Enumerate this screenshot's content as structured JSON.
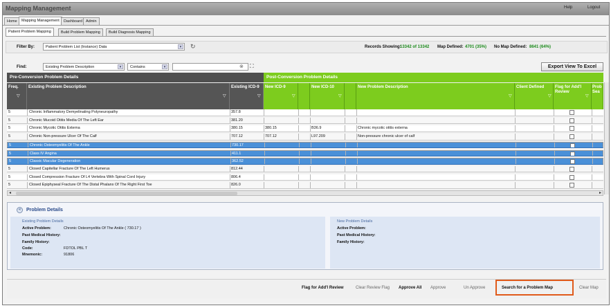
{
  "header": {
    "app_title": "Mapping Management",
    "help": "Help",
    "logout": "Logout"
  },
  "main_tabs": [
    "Home",
    "Mapping Management",
    "Dashboard",
    "Admin"
  ],
  "sub_tabs": [
    "Patient Problem Mapping",
    "Build Problem Mapping",
    "Build Diagnosis Mapping"
  ],
  "filter": {
    "label": "Filter By:",
    "value": "Patient Problem List (Instance) Data",
    "records_label": "Records Showing:",
    "records_value": "13342 of 13342",
    "map_defined_label": "Map Defined:",
    "map_defined_value": "4701 (35%)",
    "no_map_label": "No Map Defined:",
    "no_map_value": "8641 (64%)"
  },
  "find": {
    "label": "Find:",
    "field": "Existing Problem Description",
    "operator": "Contains",
    "value": "",
    "export_label": "Export View To Excel"
  },
  "table": {
    "pre_header": "Pre-Conversion Problem Details",
    "post_header": "Post-Conversion Problem Details",
    "columns": {
      "freq": "Freq.",
      "desc": "Existing Problem Description",
      "icd9": "Existing ICD-9",
      "new_icd9": "New ICD-9",
      "new_icd10": "New ICD-10",
      "new_desc": "New Problem Description",
      "client": "Client Defined",
      "flag": "Flag for Add'l Review",
      "prob": "Prob Sea"
    },
    "rows": [
      {
        "freq": "5",
        "desc": "Chronic Inflammatory Demyelinating Polyneuropathy",
        "icd9": "357.8",
        "new_icd9": "",
        "new_icd10": "",
        "new_desc": "",
        "selected": false
      },
      {
        "freq": "5",
        "desc": "Chronic Mucoid Otitis Media Of The Left Ear",
        "icd9": "381.20",
        "new_icd9": "",
        "new_icd10": "",
        "new_desc": "",
        "selected": false
      },
      {
        "freq": "5",
        "desc": "Chronic Mycotic Otitis Externa",
        "icd9": "380.15",
        "new_icd9": "380.15",
        "new_icd10": "B36.9",
        "new_desc": "Chronic mycotic otitis externa",
        "selected": false
      },
      {
        "freq": "5",
        "desc": "Chronic Non-pressure Ulcer Of The Calf",
        "icd9": "707.12",
        "new_icd9": "707.12",
        "new_icd10": "L97.209",
        "new_desc": "Non-pressure chronic ulcer of calf",
        "selected": false
      },
      {
        "freq": "5",
        "desc": "Chronic Osteomyelitis Of The Ankle",
        "icd9": "730.17",
        "new_icd9": "",
        "new_icd10": "",
        "new_desc": "",
        "selected": true
      },
      {
        "freq": "5",
        "desc": "Class IV Angina",
        "icd9": "411.1",
        "new_icd9": "",
        "new_icd10": "",
        "new_desc": "",
        "selected": true
      },
      {
        "freq": "5",
        "desc": "Classic Macular Degeneration",
        "icd9": "362.52",
        "new_icd9": "",
        "new_icd10": "",
        "new_desc": "",
        "selected": true
      },
      {
        "freq": "5",
        "desc": "Closed Capitellar Fracture Of The Left Humerus",
        "icd9": "812.44",
        "new_icd9": "",
        "new_icd10": "",
        "new_desc": "",
        "selected": false
      },
      {
        "freq": "5",
        "desc": "Closed Compression Fracture Of L4 Vertebra With Spinal Cord Injury",
        "icd9": "806.4",
        "new_icd9": "",
        "new_icd10": "",
        "new_desc": "",
        "selected": false
      },
      {
        "freq": "5",
        "desc": "Closed Epiphyseal Fracture Of The Distal Phalanx Of The Right First Toe",
        "icd9": "826.0",
        "new_icd9": "",
        "new_icd10": "",
        "new_desc": "",
        "selected": false
      }
    ]
  },
  "details": {
    "title": "Problem Details",
    "existing_header": "Existing Problem Details",
    "new_header": "New Problem Details",
    "active_problem_label": "Active Problem:",
    "active_problem_value": "Chronic Osteomyelitis Of The Ankle ( 730.17 )",
    "past_history_label": "Past Medical History:",
    "family_history_label": "Family History:",
    "code_label": "Code:",
    "code_value": "FDTOL PBL T",
    "mnemonic_label": "Mnemonic:",
    "mnemonic_value": "91806"
  },
  "actions": {
    "flag": "Flag for Add'l Review",
    "clear_flag": "Clear Review Flag",
    "approve_all": "Approve All",
    "approve": "Approve",
    "unapprove": "Un Approve",
    "search_map": "Search for a Problem Map",
    "clear_map": "Clear Map"
  },
  "colors": {
    "pre_header": "#4f4f4f",
    "post_header": "#7dcc1e",
    "selected_row": "#4a90d8",
    "highlight_box": "#e05a1a"
  }
}
